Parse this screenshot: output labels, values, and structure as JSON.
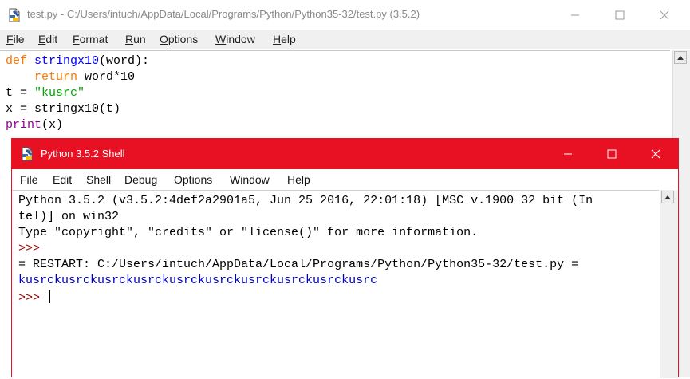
{
  "editor": {
    "title": "test.py - C:/Users/intuch/AppData/Local/Programs/Python/Python35-32/test.py (3.5.2)",
    "menu": [
      {
        "label": "File",
        "u": "F",
        "rest": "ile"
      },
      {
        "label": "Edit",
        "u": "E",
        "rest": "dit"
      },
      {
        "label": "Format",
        "u": "F",
        "rest": "ormat"
      },
      {
        "label": "Run",
        "u": "R",
        "rest": "un"
      },
      {
        "label": "Options",
        "u": "O",
        "rest": "ptions"
      },
      {
        "label": "Window",
        "u": "W",
        "rest": "indow"
      },
      {
        "label": "Help",
        "u": "H",
        "rest": "elp"
      }
    ],
    "code": {
      "l1_kw": "def",
      "l1_fn": "stringx10",
      "l1_rest": "(word):",
      "l2_indent": "    ",
      "l2_kw": "return",
      "l2_rest": " word*10",
      "l3_pre": "t = ",
      "l3_str": "\"kusrc\"",
      "l4": "x = stringx10(t)",
      "l5_bi": "print",
      "l5_rest": "(x)"
    }
  },
  "shell": {
    "title": "Python 3.5.2 Shell",
    "menu": [
      "File",
      "Edit",
      "Shell",
      "Debug",
      "Options",
      "Window",
      "Help"
    ],
    "output": {
      "banner1": "Python 3.5.2 (v3.5.2:4def2a2901a5, Jun 25 2016, 22:01:18) [MSC v.1900 32 bit (In",
      "banner2": "tel)] on win32",
      "banner3": "Type \"copyright\", \"credits\" or \"license()\" for more information.",
      "prompt1": ">>>",
      "restart": "= RESTART: C:/Users/intuch/AppData/Local/Programs/Python/Python35-32/test.py =",
      "result": "kusrckusrckusrckusrckusrckusrckusrckusrckusrckusrc",
      "prompt2": ">>> "
    }
  },
  "colors": {
    "shell_titlebar": "#e81123",
    "keyword": "#ff7700",
    "function": "#0000ff",
    "string": "#00aa00",
    "builtin": "#900090",
    "prompt": "#a00000",
    "stdout": "#0000c0"
  },
  "icons": [
    "idle-python-icon",
    "minimize-icon",
    "maximize-icon",
    "close-icon",
    "scroll-up-arrow-icon"
  ]
}
